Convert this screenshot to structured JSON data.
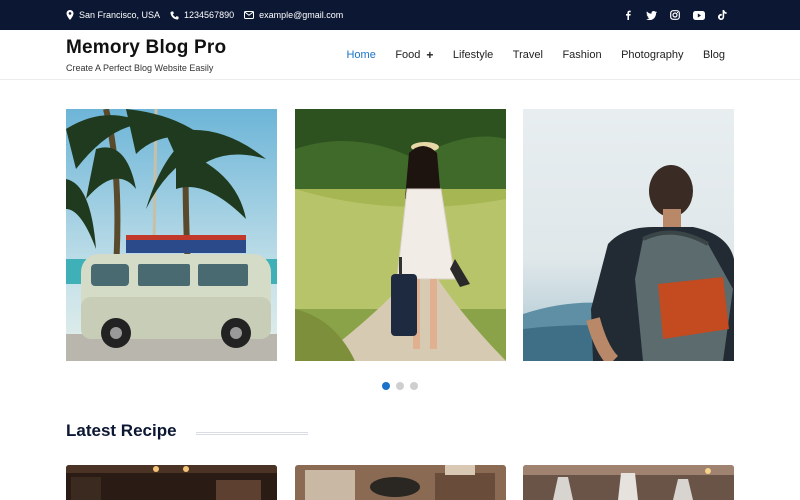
{
  "topbar": {
    "location": "San Francisco, USA",
    "phone": "1234567890",
    "email": "example@gmail.com",
    "socials": [
      "facebook-icon",
      "twitter-icon",
      "instagram-icon",
      "youtube-icon",
      "tiktok-icon"
    ]
  },
  "brand": {
    "title": "Memory Blog Pro",
    "tagline": "Create A Perfect Blog Website Easily"
  },
  "nav": {
    "items": [
      "Home",
      "Food",
      "Lifestyle",
      "Travel",
      "Fashion",
      "Photography",
      "Blog"
    ],
    "active": "Home",
    "food_expand": "+"
  },
  "slider": {
    "slides": [
      {
        "subject": "vintage van under palm trees by the beach"
      },
      {
        "subject": "woman with suitcase walking on country path"
      },
      {
        "subject": "hiker with backpack facing mountains"
      }
    ],
    "current_slide": 1,
    "slide_count": 3
  },
  "section": {
    "title": "Latest Recipe"
  },
  "colors": {
    "topbar_bg": "#0b1733",
    "accent": "#1a73c8",
    "heading": "#0b1733"
  }
}
